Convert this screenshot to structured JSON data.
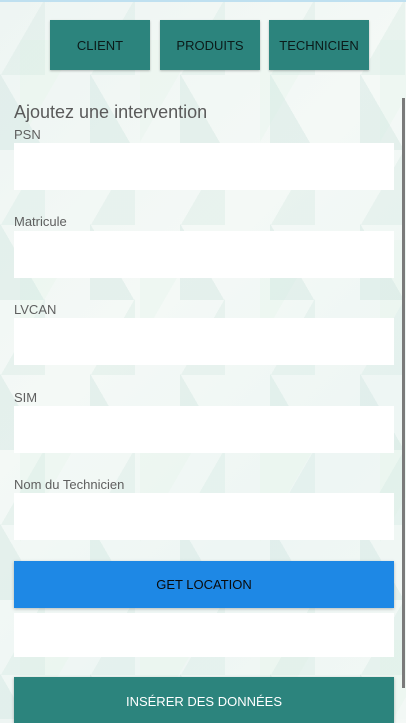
{
  "nav": {
    "client_label": "CLIENT",
    "produits_label": "PRODUITS",
    "technicien_label": "TECHNICIEN"
  },
  "form": {
    "heading": "Ajoutez une intervention",
    "fields": [
      {
        "label": "PSN",
        "value": ""
      },
      {
        "label": "Matricule",
        "value": ""
      },
      {
        "label": "LVCAN",
        "value": ""
      },
      {
        "label": "SIM",
        "value": ""
      },
      {
        "label": "Nom du Technicien",
        "value": ""
      }
    ],
    "get_location_label": "GET LOCATION",
    "location_value": "",
    "insert_label": "INSÉRER DES DONNÉES"
  },
  "colors": {
    "primary_teal": "#2c847d",
    "accent_blue": "#1e88e5"
  }
}
